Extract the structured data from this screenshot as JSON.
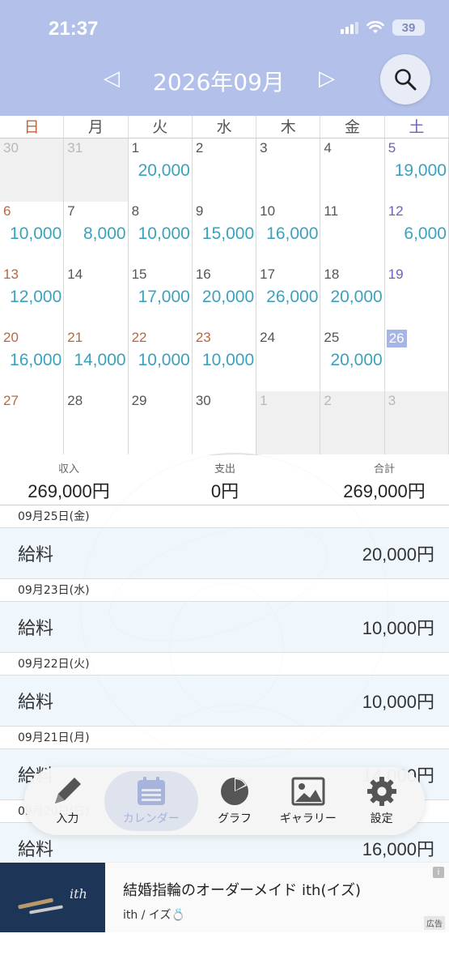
{
  "status": {
    "time": "21:37",
    "battery": "39"
  },
  "header": {
    "prev_icon": "◁",
    "next_icon": "▷",
    "title": "2026年09月"
  },
  "weekdays": [
    "日",
    "月",
    "火",
    "水",
    "木",
    "金",
    "土"
  ],
  "weeks": [
    [
      {
        "d": "30",
        "o": true,
        "a": ""
      },
      {
        "d": "31",
        "o": true,
        "a": ""
      },
      {
        "d": "1",
        "a": "20,000"
      },
      {
        "d": "2",
        "a": ""
      },
      {
        "d": "3",
        "a": ""
      },
      {
        "d": "4",
        "a": ""
      },
      {
        "d": "5",
        "a": "19,000"
      }
    ],
    [
      {
        "d": "6",
        "a": "10,000"
      },
      {
        "d": "7",
        "a": "8,000"
      },
      {
        "d": "8",
        "a": "10,000"
      },
      {
        "d": "9",
        "a": "15,000"
      },
      {
        "d": "10",
        "a": "16,000"
      },
      {
        "d": "11",
        "a": ""
      },
      {
        "d": "12",
        "a": "6,000"
      }
    ],
    [
      {
        "d": "13",
        "a": "12,000"
      },
      {
        "d": "14",
        "a": ""
      },
      {
        "d": "15",
        "a": "17,000"
      },
      {
        "d": "16",
        "a": "20,000"
      },
      {
        "d": "17",
        "a": "26,000"
      },
      {
        "d": "18",
        "a": "20,000"
      },
      {
        "d": "19",
        "a": ""
      }
    ],
    [
      {
        "d": "20",
        "a": "16,000",
        "h": true
      },
      {
        "d": "21",
        "a": "14,000",
        "h": true
      },
      {
        "d": "22",
        "a": "10,000",
        "h": true
      },
      {
        "d": "23",
        "a": "10,000",
        "h": true
      },
      {
        "d": "24",
        "a": ""
      },
      {
        "d": "25",
        "a": "20,000"
      },
      {
        "d": "26",
        "a": "",
        "today": true
      }
    ],
    [
      {
        "d": "27",
        "a": ""
      },
      {
        "d": "28",
        "a": ""
      },
      {
        "d": "29",
        "a": ""
      },
      {
        "d": "30",
        "a": ""
      },
      {
        "d": "1",
        "o": true,
        "a": ""
      },
      {
        "d": "2",
        "o": true,
        "a": ""
      },
      {
        "d": "3",
        "o": true,
        "a": ""
      }
    ]
  ],
  "summary": {
    "income_label": "収入",
    "income": "269,000円",
    "expense_label": "支出",
    "expense": "0円",
    "total_label": "合計",
    "total": "269,000円"
  },
  "entries": [
    {
      "date": "09月25日(金)",
      "label": "給料",
      "amount": "20,000円"
    },
    {
      "date": "09月23日(水)",
      "label": "給料",
      "amount": "10,000円"
    },
    {
      "date": "09月22日(火)",
      "label": "給料",
      "amount": "10,000円"
    },
    {
      "date": "09月21日(月)",
      "label": "給料",
      "amount": "14,000円"
    },
    {
      "date": "09月20日(日)",
      "label": "給料",
      "amount": "16,000円"
    }
  ],
  "tabs": [
    {
      "label": "入力",
      "icon": "pencil-icon"
    },
    {
      "label": "カレンダー",
      "icon": "calendar-icon",
      "active": true
    },
    {
      "label": "グラフ",
      "icon": "pie-chart-icon"
    },
    {
      "label": "ギャラリー",
      "icon": "image-icon"
    },
    {
      "label": "設定",
      "icon": "gear-icon"
    }
  ],
  "ad": {
    "title": "結婚指輪のオーダーメイド ith(イズ)",
    "subtitle": "ith / イズ💍",
    "badge": "広告",
    "info": "i",
    "image_text": "ith"
  },
  "colors": {
    "header": "#b3c1ea",
    "amount": "#3aa2bf",
    "sunday": "#c0653a",
    "saturday": "#7060b8",
    "today": "#a7b5e6"
  }
}
